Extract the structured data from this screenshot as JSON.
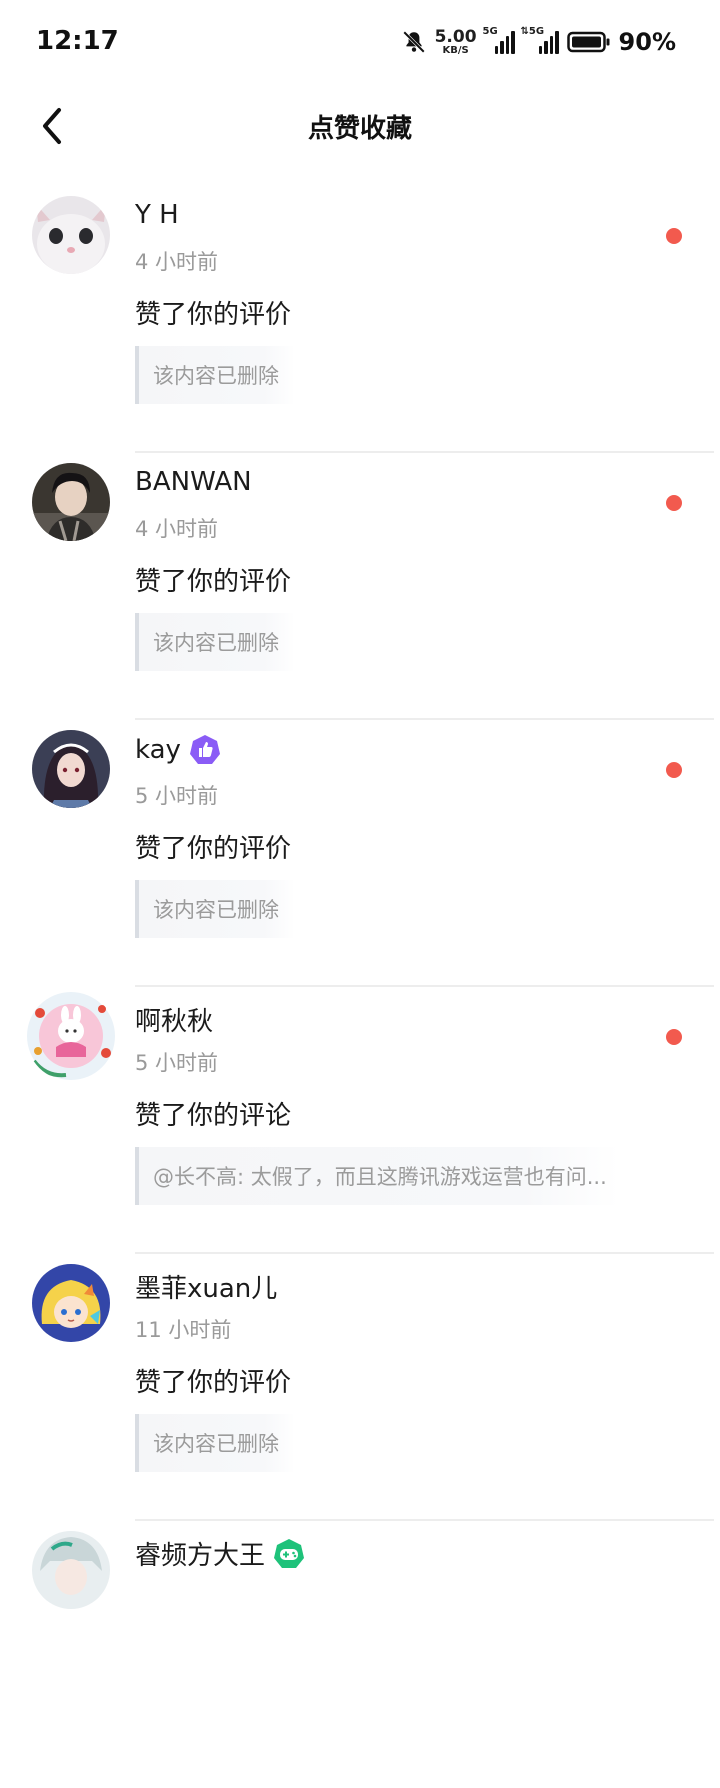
{
  "status_bar": {
    "time": "12:17",
    "net_speed": "5.00",
    "net_unit": "KB/S",
    "sim1_tag": "5G",
    "sim2_tag": "⇅5G",
    "battery": "90%"
  },
  "header": {
    "title": "点赞收藏",
    "back_icon": "chevron-left-icon"
  },
  "notifications": [
    {
      "name": "Y H",
      "time": "4 小时前",
      "action": "赞了你的评价",
      "quote": "该内容已删除",
      "unread": true,
      "badge": null
    },
    {
      "name": "BANWAN",
      "time": "4 小时前",
      "action": "赞了你的评价",
      "quote": "该内容已删除",
      "unread": true,
      "badge": null
    },
    {
      "name": "kay",
      "time": "5 小时前",
      "action": "赞了你的评价",
      "quote": "该内容已删除",
      "unread": true,
      "badge": "thumbs-up-badge"
    },
    {
      "name": "啊秋秋",
      "time": "5 小时前",
      "action": "赞了你的评论",
      "quote": "@长不高: 太假了，而且这腾讯游戏运营也有问...",
      "unread": true,
      "badge": null
    },
    {
      "name": "墨菲xuan儿",
      "time": "11 小时前",
      "action": "赞了你的评价",
      "quote": "该内容已删除",
      "unread": false,
      "badge": null
    },
    {
      "name": "睿频方大王",
      "time": "",
      "action": "",
      "quote": "",
      "unread": false,
      "badge": "gamepad-badge"
    }
  ],
  "colors": {
    "unread_dot": "#f25a4e",
    "badge_purple": "#8a5cf6",
    "badge_green": "#1ec27a"
  }
}
